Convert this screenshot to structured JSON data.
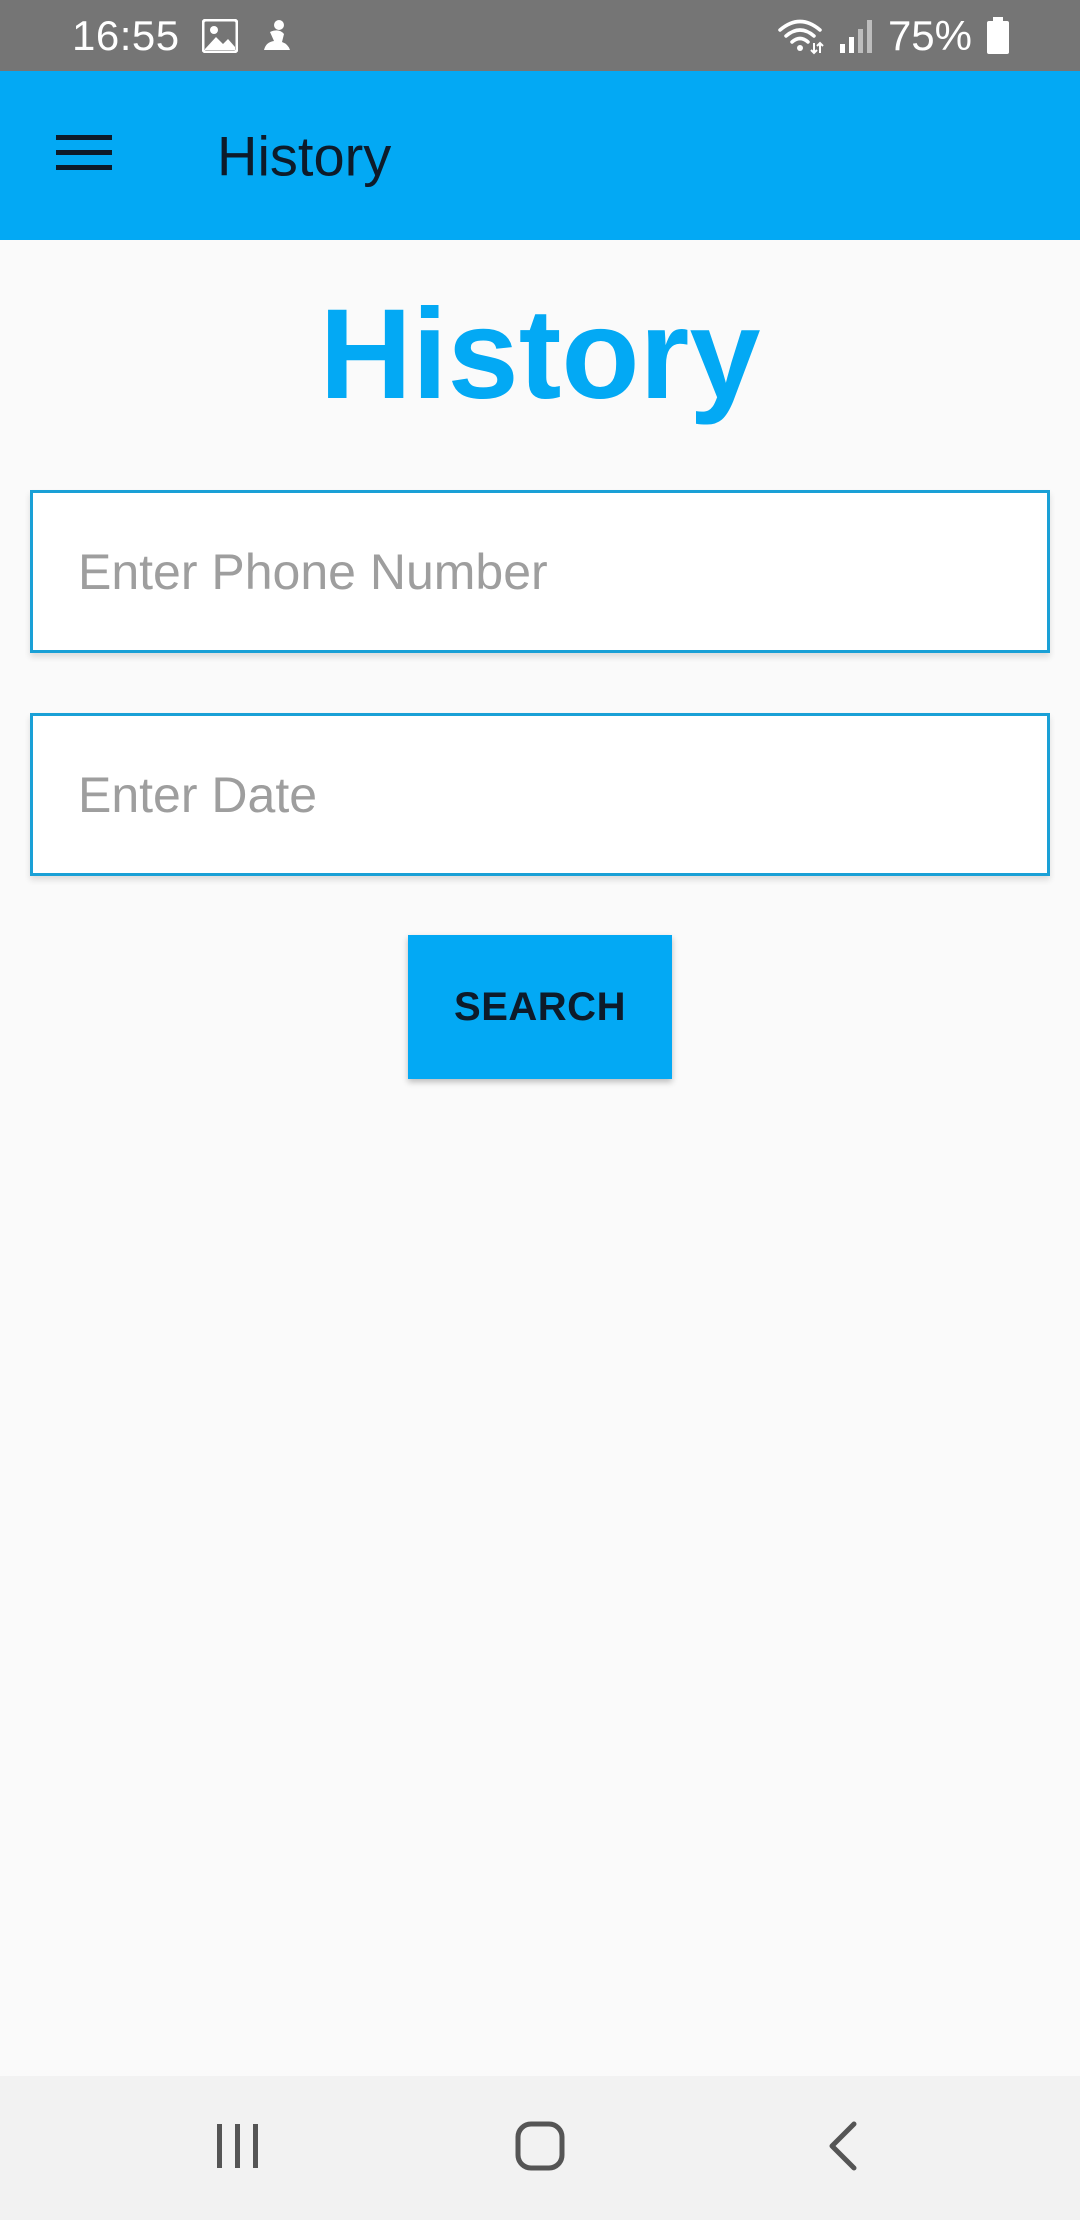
{
  "status_bar": {
    "time": "16:55",
    "battery_percent": "75%",
    "icons": [
      "gallery-icon",
      "notification-icon",
      "wifi-icon",
      "signal-icon",
      "battery-icon"
    ]
  },
  "app_bar": {
    "title": "History",
    "menu_icon": "hamburger-menu-icon",
    "color": "#03a9f4"
  },
  "main": {
    "heading": "History",
    "heading_color": "#03a9f4",
    "phone_field": {
      "placeholder": "Enter Phone Number",
      "value": ""
    },
    "date_field": {
      "placeholder": "Enter Date",
      "value": ""
    },
    "search_button": {
      "label": "SEARCH"
    }
  },
  "nav_bar": {
    "items": [
      "recent-apps-icon",
      "home-icon",
      "back-icon"
    ]
  }
}
